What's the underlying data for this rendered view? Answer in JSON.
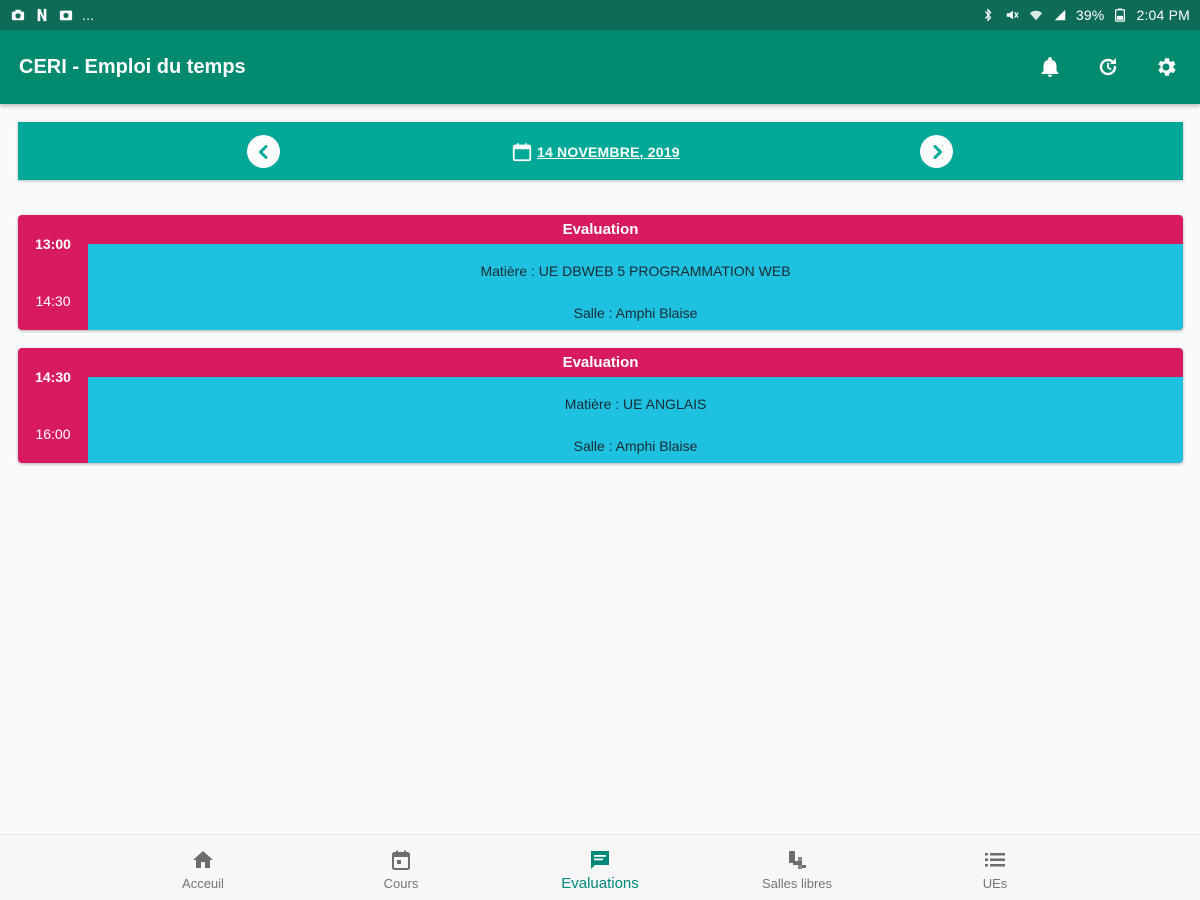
{
  "status_bar": {
    "left_text": "...",
    "battery": "39%",
    "time": "2:04 PM"
  },
  "app_bar": {
    "title": "CERI - Emploi du temps",
    "actions": [
      "bell-icon",
      "refresh-icon",
      "gear-icon"
    ]
  },
  "date_nav": {
    "date_label": "14 NOVEMBRE, 2019"
  },
  "events": [
    {
      "type": "Evaluation",
      "start": "13:00",
      "end": "14:30",
      "subject": "Matière : UE DBWEB 5 PROGRAMMATION WEB",
      "room": "Salle : Amphi Blaise"
    },
    {
      "type": "Evaluation",
      "start": "14:30",
      "end": "16:00",
      "subject": "Matière : UE ANGLAIS",
      "room": "Salle : Amphi Blaise"
    }
  ],
  "bottom_nav": {
    "items": [
      {
        "label": "Acceuil",
        "icon": "home-icon"
      },
      {
        "label": "Cours",
        "icon": "calendar-icon"
      },
      {
        "label": "Evaluations",
        "icon": "chat-icon",
        "active": true
      },
      {
        "label": "Salles libres",
        "icon": "room-icon"
      },
      {
        "label": "UEs",
        "icon": "list-icon"
      }
    ]
  },
  "colors": {
    "status_bar": "#0d6b57",
    "app_bar": "#008a6e",
    "date_bar": "#00a997",
    "event_accent": "#d81b60",
    "event_body": "#1ec2e0",
    "nav_active": "#00897b"
  }
}
